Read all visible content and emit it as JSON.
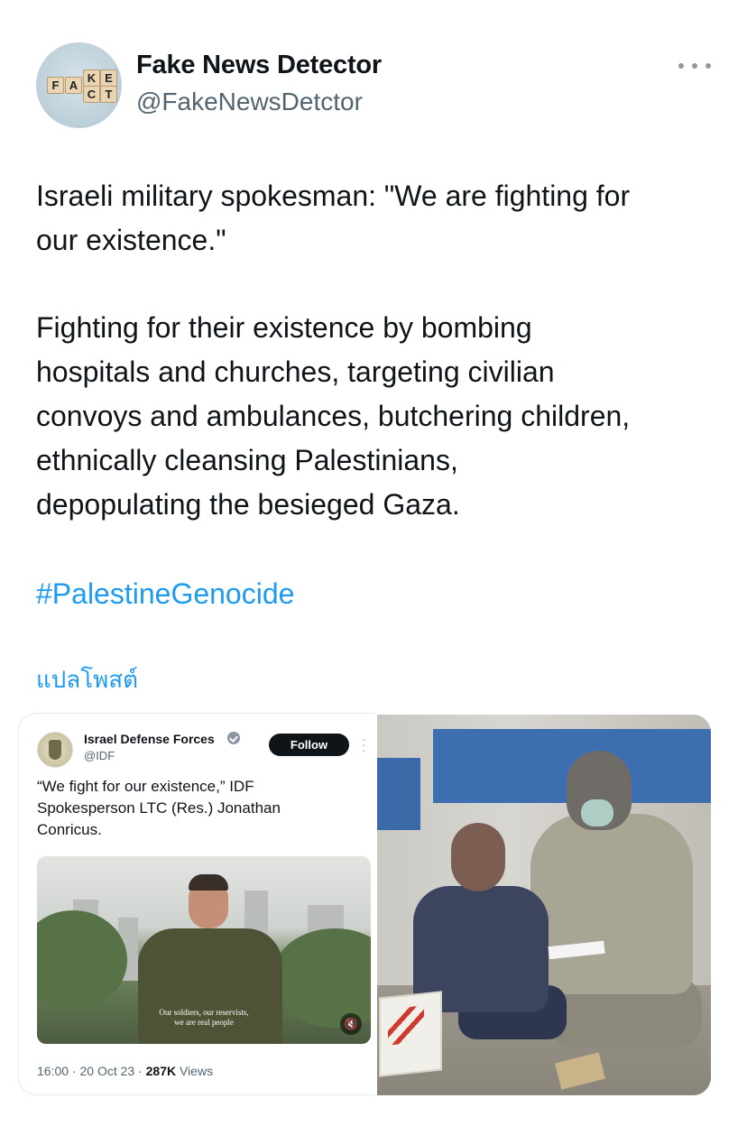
{
  "account": {
    "display_name": "Fake News Detector",
    "handle": "@FakeNewsDetctor",
    "avatar_letters": [
      "F",
      "A",
      "K",
      "E",
      "C",
      "T"
    ]
  },
  "post": {
    "line1": "Israeli military spokesman: \"We are fighting for",
    "line2": "our existence.\"",
    "para2_line1": "Fighting for their existence by bombing",
    "para2_line2": "hospitals and churches, targeting civilian",
    "para2_line3": "convoys and ambulances, butchering children,",
    "para2_line4": "ethnically cleansing Palestinians,",
    "para2_line5": "depopulating the besieged Gaza.",
    "hashtag": "#PalestineGenocide",
    "translate_label": "แปลโพสต์"
  },
  "embedded_tweet": {
    "name": "Israel Defense Forces",
    "handle": "@IDF",
    "follow_label": "Follow",
    "text": "“We fight for our existence,” IDF Spokesperson LTC (Res.) Jonathan Conricus.",
    "video_caption_1": "Our soldiers, our reservists,",
    "video_caption_2": "we are real people",
    "meta_time": "16:00 · 20 Oct 23 · ",
    "meta_views_count": "287K",
    "meta_views_label": " Views"
  },
  "colors": {
    "link": "#1d9bf0",
    "text": "#0f1419",
    "secondary": "#536471"
  },
  "icons": {
    "more": "more-horizontal-icon",
    "verified": "verified-badge-icon",
    "mute": "muted-speaker-icon"
  }
}
